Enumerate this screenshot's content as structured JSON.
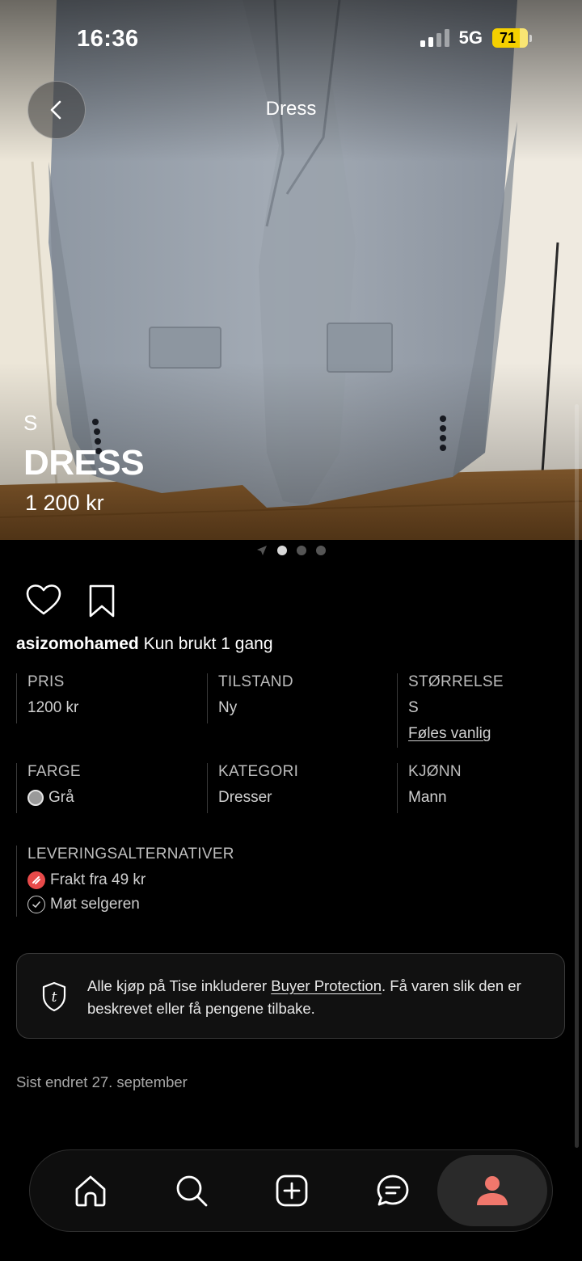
{
  "status_bar": {
    "time": "16:36",
    "network": "5G",
    "battery": "71"
  },
  "header": {
    "title": "Dress",
    "back_icon": "chevron-left-icon"
  },
  "hero": {
    "size": "S",
    "name": "DRESS",
    "price": "1 200 kr",
    "image_count": 3,
    "active_image": 1
  },
  "actions": {
    "like_icon": "heart-icon",
    "save_icon": "bookmark-icon"
  },
  "description": {
    "username": "asizomohamed",
    "text": "Kun brukt 1 gang"
  },
  "attributes": {
    "price": {
      "label": "PRIS",
      "value": "1200 kr"
    },
    "condition": {
      "label": "TILSTAND",
      "value": "Ny"
    },
    "size": {
      "label": "STØRRELSE",
      "value": "S",
      "fit": "Føles vanlig"
    },
    "color": {
      "label": "FARGE",
      "value": "Grå",
      "swatch": "#9a9a9a"
    },
    "category": {
      "label": "KATEGORI",
      "value": "Dresser"
    },
    "gender": {
      "label": "KJØNN",
      "value": "Mann"
    }
  },
  "delivery": {
    "label": "LEVERINGSALTERNATIVER",
    "options": [
      {
        "text": "Frakt fra 49 kr",
        "icon": "shipping-icon",
        "color": "#e84a4a"
      },
      {
        "text": "Møt selgeren",
        "icon": "check-circle-icon"
      }
    ]
  },
  "buyer_protection": {
    "prefix": "Alle kjøp på Tise inkluderer ",
    "link": "Buyer Protection",
    "suffix": ". Få varen slik den er beskrevet eller få pengene tilbake.",
    "icon": "tise-shield-icon"
  },
  "last_edited": "Sist endret 27. september",
  "tab_bar": {
    "items": [
      {
        "name": "home",
        "icon": "home-icon"
      },
      {
        "name": "search",
        "icon": "search-icon"
      },
      {
        "name": "sell",
        "icon": "plus-square-icon"
      },
      {
        "name": "messages",
        "icon": "chat-icon"
      },
      {
        "name": "profile",
        "icon": "profile-icon",
        "active": true,
        "accent": "#f0776c"
      }
    ]
  }
}
